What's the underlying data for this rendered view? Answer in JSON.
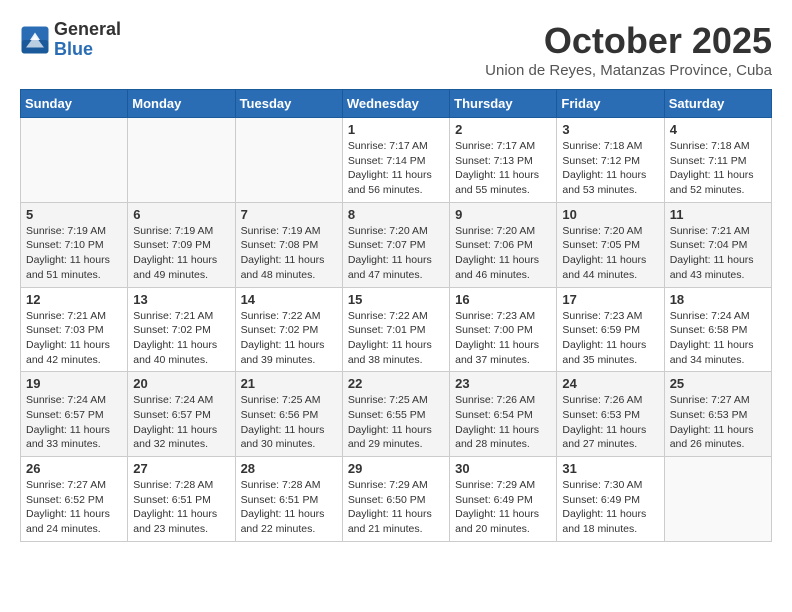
{
  "logo": {
    "general": "General",
    "blue": "Blue"
  },
  "header": {
    "month": "October 2025",
    "location": "Union de Reyes, Matanzas Province, Cuba"
  },
  "weekdays": [
    "Sunday",
    "Monday",
    "Tuesday",
    "Wednesday",
    "Thursday",
    "Friday",
    "Saturday"
  ],
  "weeks": [
    [
      {
        "day": "",
        "sunrise": "",
        "sunset": "",
        "daylight": ""
      },
      {
        "day": "",
        "sunrise": "",
        "sunset": "",
        "daylight": ""
      },
      {
        "day": "",
        "sunrise": "",
        "sunset": "",
        "daylight": ""
      },
      {
        "day": "1",
        "sunrise": "Sunrise: 7:17 AM",
        "sunset": "Sunset: 7:14 PM",
        "daylight": "Daylight: 11 hours and 56 minutes."
      },
      {
        "day": "2",
        "sunrise": "Sunrise: 7:17 AM",
        "sunset": "Sunset: 7:13 PM",
        "daylight": "Daylight: 11 hours and 55 minutes."
      },
      {
        "day": "3",
        "sunrise": "Sunrise: 7:18 AM",
        "sunset": "Sunset: 7:12 PM",
        "daylight": "Daylight: 11 hours and 53 minutes."
      },
      {
        "day": "4",
        "sunrise": "Sunrise: 7:18 AM",
        "sunset": "Sunset: 7:11 PM",
        "daylight": "Daylight: 11 hours and 52 minutes."
      }
    ],
    [
      {
        "day": "5",
        "sunrise": "Sunrise: 7:19 AM",
        "sunset": "Sunset: 7:10 PM",
        "daylight": "Daylight: 11 hours and 51 minutes."
      },
      {
        "day": "6",
        "sunrise": "Sunrise: 7:19 AM",
        "sunset": "Sunset: 7:09 PM",
        "daylight": "Daylight: 11 hours and 49 minutes."
      },
      {
        "day": "7",
        "sunrise": "Sunrise: 7:19 AM",
        "sunset": "Sunset: 7:08 PM",
        "daylight": "Daylight: 11 hours and 48 minutes."
      },
      {
        "day": "8",
        "sunrise": "Sunrise: 7:20 AM",
        "sunset": "Sunset: 7:07 PM",
        "daylight": "Daylight: 11 hours and 47 minutes."
      },
      {
        "day": "9",
        "sunrise": "Sunrise: 7:20 AM",
        "sunset": "Sunset: 7:06 PM",
        "daylight": "Daylight: 11 hours and 46 minutes."
      },
      {
        "day": "10",
        "sunrise": "Sunrise: 7:20 AM",
        "sunset": "Sunset: 7:05 PM",
        "daylight": "Daylight: 11 hours and 44 minutes."
      },
      {
        "day": "11",
        "sunrise": "Sunrise: 7:21 AM",
        "sunset": "Sunset: 7:04 PM",
        "daylight": "Daylight: 11 hours and 43 minutes."
      }
    ],
    [
      {
        "day": "12",
        "sunrise": "Sunrise: 7:21 AM",
        "sunset": "Sunset: 7:03 PM",
        "daylight": "Daylight: 11 hours and 42 minutes."
      },
      {
        "day": "13",
        "sunrise": "Sunrise: 7:21 AM",
        "sunset": "Sunset: 7:02 PM",
        "daylight": "Daylight: 11 hours and 40 minutes."
      },
      {
        "day": "14",
        "sunrise": "Sunrise: 7:22 AM",
        "sunset": "Sunset: 7:02 PM",
        "daylight": "Daylight: 11 hours and 39 minutes."
      },
      {
        "day": "15",
        "sunrise": "Sunrise: 7:22 AM",
        "sunset": "Sunset: 7:01 PM",
        "daylight": "Daylight: 11 hours and 38 minutes."
      },
      {
        "day": "16",
        "sunrise": "Sunrise: 7:23 AM",
        "sunset": "Sunset: 7:00 PM",
        "daylight": "Daylight: 11 hours and 37 minutes."
      },
      {
        "day": "17",
        "sunrise": "Sunrise: 7:23 AM",
        "sunset": "Sunset: 6:59 PM",
        "daylight": "Daylight: 11 hours and 35 minutes."
      },
      {
        "day": "18",
        "sunrise": "Sunrise: 7:24 AM",
        "sunset": "Sunset: 6:58 PM",
        "daylight": "Daylight: 11 hours and 34 minutes."
      }
    ],
    [
      {
        "day": "19",
        "sunrise": "Sunrise: 7:24 AM",
        "sunset": "Sunset: 6:57 PM",
        "daylight": "Daylight: 11 hours and 33 minutes."
      },
      {
        "day": "20",
        "sunrise": "Sunrise: 7:24 AM",
        "sunset": "Sunset: 6:57 PM",
        "daylight": "Daylight: 11 hours and 32 minutes."
      },
      {
        "day": "21",
        "sunrise": "Sunrise: 7:25 AM",
        "sunset": "Sunset: 6:56 PM",
        "daylight": "Daylight: 11 hours and 30 minutes."
      },
      {
        "day": "22",
        "sunrise": "Sunrise: 7:25 AM",
        "sunset": "Sunset: 6:55 PM",
        "daylight": "Daylight: 11 hours and 29 minutes."
      },
      {
        "day": "23",
        "sunrise": "Sunrise: 7:26 AM",
        "sunset": "Sunset: 6:54 PM",
        "daylight": "Daylight: 11 hours and 28 minutes."
      },
      {
        "day": "24",
        "sunrise": "Sunrise: 7:26 AM",
        "sunset": "Sunset: 6:53 PM",
        "daylight": "Daylight: 11 hours and 27 minutes."
      },
      {
        "day": "25",
        "sunrise": "Sunrise: 7:27 AM",
        "sunset": "Sunset: 6:53 PM",
        "daylight": "Daylight: 11 hours and 26 minutes."
      }
    ],
    [
      {
        "day": "26",
        "sunrise": "Sunrise: 7:27 AM",
        "sunset": "Sunset: 6:52 PM",
        "daylight": "Daylight: 11 hours and 24 minutes."
      },
      {
        "day": "27",
        "sunrise": "Sunrise: 7:28 AM",
        "sunset": "Sunset: 6:51 PM",
        "daylight": "Daylight: 11 hours and 23 minutes."
      },
      {
        "day": "28",
        "sunrise": "Sunrise: 7:28 AM",
        "sunset": "Sunset: 6:51 PM",
        "daylight": "Daylight: 11 hours and 22 minutes."
      },
      {
        "day": "29",
        "sunrise": "Sunrise: 7:29 AM",
        "sunset": "Sunset: 6:50 PM",
        "daylight": "Daylight: 11 hours and 21 minutes."
      },
      {
        "day": "30",
        "sunrise": "Sunrise: 7:29 AM",
        "sunset": "Sunset: 6:49 PM",
        "daylight": "Daylight: 11 hours and 20 minutes."
      },
      {
        "day": "31",
        "sunrise": "Sunrise: 7:30 AM",
        "sunset": "Sunset: 6:49 PM",
        "daylight": "Daylight: 11 hours and 18 minutes."
      },
      {
        "day": "",
        "sunrise": "",
        "sunset": "",
        "daylight": ""
      }
    ]
  ]
}
